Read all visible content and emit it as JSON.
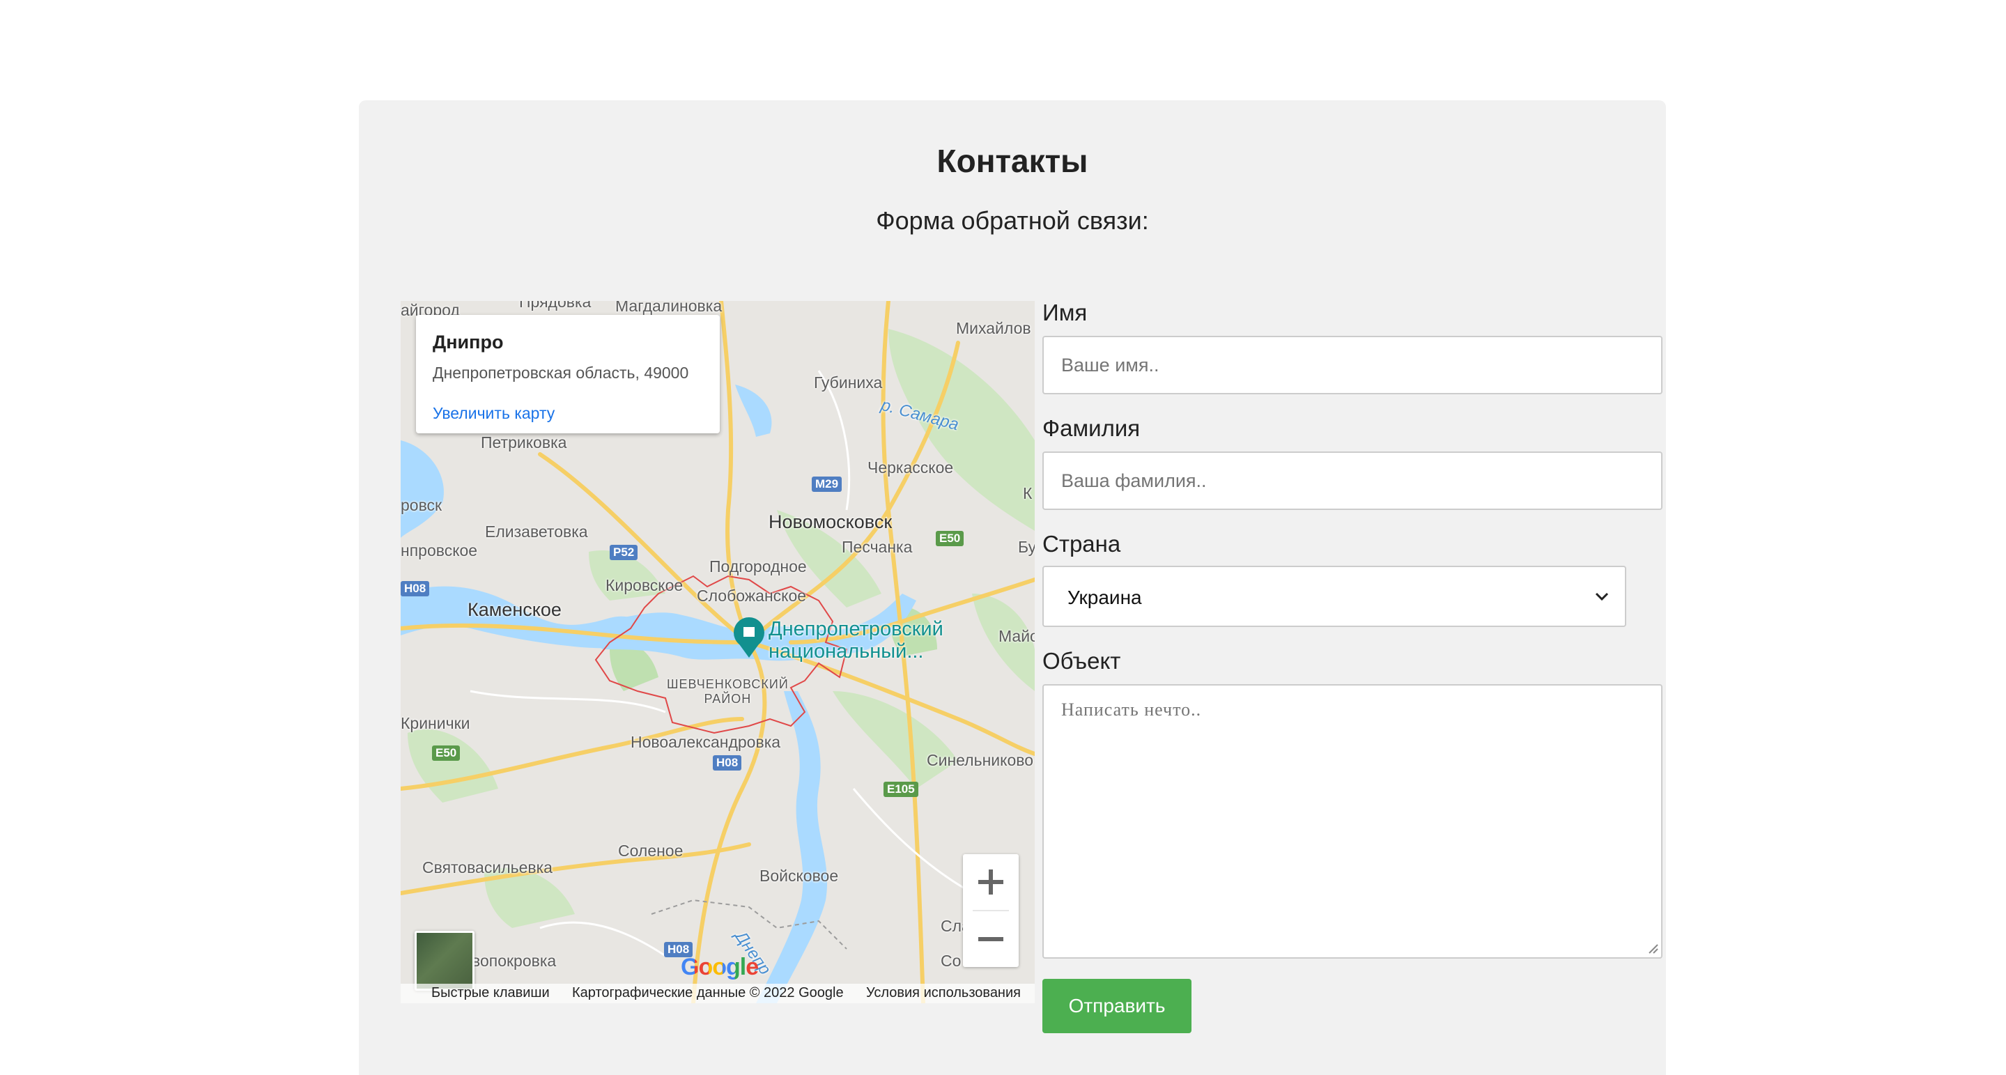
{
  "page": {
    "title": "Контакты",
    "subtitle": "Форма обратной связи:"
  },
  "map": {
    "info": {
      "place": "Днипро",
      "address": "Днепропетровская область, 49000",
      "enlarge_link": "Увеличить карту"
    },
    "labels": {
      "pryadovka": "Прядовка",
      "magdalinovka": "Магдалиновка",
      "aigorod": "айгород",
      "mikhailov": "Михайлов",
      "gubinikha": "Губиниха",
      "samara": "р. Самара",
      "petrikovka": "Петриковка",
      "cherkasskoe": "Черкасское",
      "k": "К",
      "rovsk": "ровск",
      "elizavetovka": "Елизаветовка",
      "novomoskovsk": "Новомосковск",
      "peschanka": "Песчанка",
      "bu": "Бу",
      "nprovskoe": "нпровское",
      "podgorodnoe": "Подгородное",
      "kirovskoe": "Кировское",
      "slobozhanskoe": "Слобожанское",
      "kamenskoe": "Каменское",
      "university_line1": "Днепропетровский",
      "university_line2": "национальный...",
      "maio": "Майо",
      "shevchenko_line1": "ШЕВЧЕНКОВСКИЙ",
      "shevchenko_line2": "РАЙОН",
      "krinichki": "Кринички",
      "novoaleksandrovka": "Новоалександровка",
      "sinelnikovo": "Синельниково",
      "solenoe": "Соленое",
      "svyatovasilevka": "Святовасильевка",
      "voiskovoe": "Войсковое",
      "sla": "Сла",
      "vopokrovka": "вопокровка",
      "dnepr": "Днепр",
      "so": "Со"
    },
    "shields": {
      "m29": "M29",
      "r52": "P52",
      "h08_left": "H08",
      "e50_right": "E50",
      "e50_left": "E50",
      "h08_mid": "H08",
      "e105": "E105",
      "h08_bottom": "H08"
    },
    "attribution": {
      "shortcuts": "Быстрые клавиши",
      "data": "Картографические данные © 2022 Google",
      "terms": "Условия использования"
    },
    "logo": "Google"
  },
  "form": {
    "first_name": {
      "label": "Имя",
      "placeholder": "Ваше имя..",
      "value": ""
    },
    "last_name": {
      "label": "Фамилия",
      "placeholder": "Ваша фамилия..",
      "value": ""
    },
    "country": {
      "label": "Страна",
      "selected": "Украина"
    },
    "subject": {
      "label": "Объект",
      "placeholder": "Написать нечто..",
      "value": ""
    },
    "submit_label": "Отправить"
  },
  "colors": {
    "submit": "#4caf50",
    "card_bg": "#f1f1f1",
    "link": "#1a73e8",
    "poi": "#11908f"
  }
}
